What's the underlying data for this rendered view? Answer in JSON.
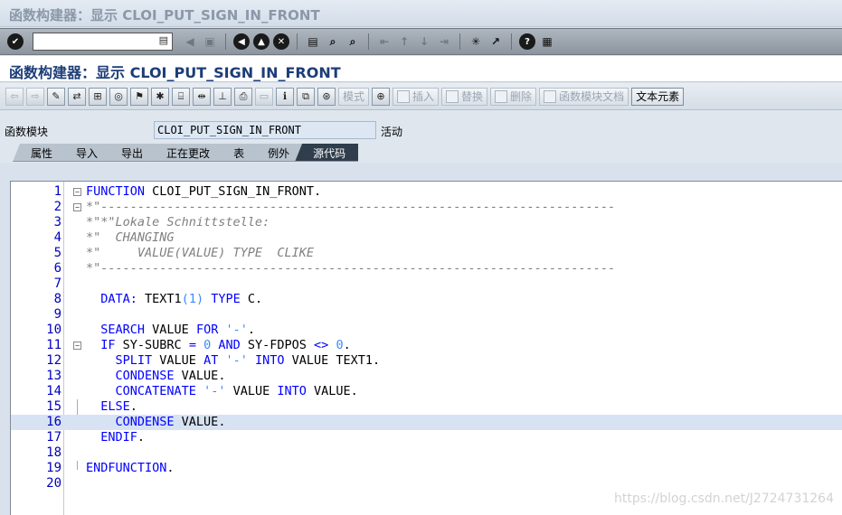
{
  "window": {
    "title": "函数构建器：显示 CLOI_PUT_SIGN_IN_FRONT"
  },
  "system_toolbar": {
    "icons": [
      "enter-icon",
      "command-field",
      "back-arrow-icon",
      "save-icon",
      "back-icon",
      "exit-icon",
      "cancel-icon",
      "print-icon",
      "find-icon",
      "find-next-icon",
      "first-page-icon",
      "prev-page-icon",
      "next-page-icon",
      "last-page-icon",
      "new-session-icon",
      "shortcut-icon",
      "help-icon",
      "customize-icon"
    ]
  },
  "app": {
    "title": "函数构建器：显示 CLOI_PUT_SIGN_IN_FRONT"
  },
  "app_toolbar": {
    "pattern_label": "模式",
    "insert_label": "插入",
    "replace_label": "替换",
    "delete_label": "删除",
    "fm_doc_label": "函数模块文档",
    "text_elements_label": "文本元素"
  },
  "function_module": {
    "label": "函数模块",
    "name": "CLOI_PUT_SIGN_IN_FRONT",
    "status": "活动"
  },
  "tabs": [
    {
      "label": "属性",
      "active": false
    },
    {
      "label": "导入",
      "active": false
    },
    {
      "label": "导出",
      "active": false
    },
    {
      "label": "正在更改",
      "active": false
    },
    {
      "label": "表",
      "active": false
    },
    {
      "label": "例外",
      "active": false
    },
    {
      "label": "源代码",
      "active": true
    }
  ],
  "code": {
    "highlighted_line": 16,
    "lines": [
      {
        "n": "1",
        "fold": "minus",
        "tokens": [
          [
            "kw",
            "FUNCTION"
          ],
          [
            "pl",
            " CLOI_PUT_SIGN_IN_FRONT."
          ]
        ]
      },
      {
        "n": "2",
        "fold": "minus",
        "tokens": [
          [
            "cm",
            "*\"----------------------------------------------------------------------"
          ]
        ]
      },
      {
        "n": "3",
        "fold": "",
        "tokens": [
          [
            "cm",
            "*\"*\"Lokale Schnittstelle:"
          ]
        ]
      },
      {
        "n": "4",
        "fold": "",
        "tokens": [
          [
            "cm",
            "*\"  CHANGING"
          ]
        ]
      },
      {
        "n": "5",
        "fold": "",
        "tokens": [
          [
            "cm",
            "*\"     VALUE(VALUE) TYPE  CLIKE"
          ]
        ]
      },
      {
        "n": "6",
        "fold": "",
        "tokens": [
          [
            "cm",
            "*\"----------------------------------------------------------------------"
          ]
        ]
      },
      {
        "n": "7",
        "fold": "",
        "tokens": []
      },
      {
        "n": "8",
        "fold": "",
        "tokens": [
          [
            "pl",
            "  "
          ],
          [
            "kw",
            "DATA:"
          ],
          [
            "pl",
            " TEXT1"
          ],
          [
            "num",
            "(1)"
          ],
          [
            "pl",
            " "
          ],
          [
            "kw",
            "TYPE"
          ],
          [
            "pl",
            " C."
          ]
        ]
      },
      {
        "n": "9",
        "fold": "",
        "tokens": []
      },
      {
        "n": "10",
        "fold": "",
        "tokens": [
          [
            "pl",
            "  "
          ],
          [
            "kw",
            "SEARCH"
          ],
          [
            "pl",
            " VALUE "
          ],
          [
            "kw",
            "FOR"
          ],
          [
            "pl",
            " "
          ],
          [
            "str",
            "'-'"
          ],
          [
            "pl",
            "."
          ]
        ]
      },
      {
        "n": "11",
        "fold": "minus",
        "tokens": [
          [
            "pl",
            "  "
          ],
          [
            "kw",
            "IF"
          ],
          [
            "pl",
            " SY-SUBRC "
          ],
          [
            "kw",
            "="
          ],
          [
            "pl",
            " "
          ],
          [
            "num",
            "0"
          ],
          [
            "pl",
            " "
          ],
          [
            "kw",
            "AND"
          ],
          [
            "pl",
            " SY-FDPOS "
          ],
          [
            "kw",
            "<>"
          ],
          [
            "pl",
            " "
          ],
          [
            "num",
            "0"
          ],
          [
            "pl",
            "."
          ]
        ]
      },
      {
        "n": "12",
        "fold": "",
        "tokens": [
          [
            "pl",
            "    "
          ],
          [
            "kw",
            "SPLIT"
          ],
          [
            "pl",
            " VALUE "
          ],
          [
            "kw",
            "AT"
          ],
          [
            "pl",
            " "
          ],
          [
            "str",
            "'-'"
          ],
          [
            "pl",
            " "
          ],
          [
            "kw",
            "INTO"
          ],
          [
            "pl",
            " VALUE TEXT1."
          ]
        ]
      },
      {
        "n": "13",
        "fold": "",
        "tokens": [
          [
            "pl",
            "    "
          ],
          [
            "kw",
            "CONDENSE"
          ],
          [
            "pl",
            " VALUE."
          ]
        ]
      },
      {
        "n": "14",
        "fold": "",
        "tokens": [
          [
            "pl",
            "    "
          ],
          [
            "kw",
            "CONCATENATE"
          ],
          [
            "pl",
            " "
          ],
          [
            "str",
            "'-'"
          ],
          [
            "pl",
            " VALUE "
          ],
          [
            "kw",
            "INTO"
          ],
          [
            "pl",
            " VALUE."
          ]
        ]
      },
      {
        "n": "15",
        "fold": "dot",
        "tokens": [
          [
            "pl",
            "  "
          ],
          [
            "kw",
            "ELSE"
          ],
          [
            "pl",
            "."
          ]
        ]
      },
      {
        "n": "16",
        "fold": "",
        "tokens": [
          [
            "pl",
            "    "
          ],
          [
            "kw",
            "CONDENSE"
          ],
          [
            "pl",
            " VALUE."
          ]
        ]
      },
      {
        "n": "17",
        "fold": "",
        "tokens": [
          [
            "pl",
            "  "
          ],
          [
            "kw",
            "ENDIF"
          ],
          [
            "pl",
            "."
          ]
        ]
      },
      {
        "n": "18",
        "fold": "",
        "tokens": []
      },
      {
        "n": "19",
        "fold": "end",
        "tokens": [
          [
            "kw",
            "ENDFUNCTION"
          ],
          [
            "pl",
            "."
          ]
        ]
      },
      {
        "n": "20",
        "fold": "",
        "tokens": []
      }
    ]
  },
  "watermark": "https://blog.csdn.net/J2724731264"
}
